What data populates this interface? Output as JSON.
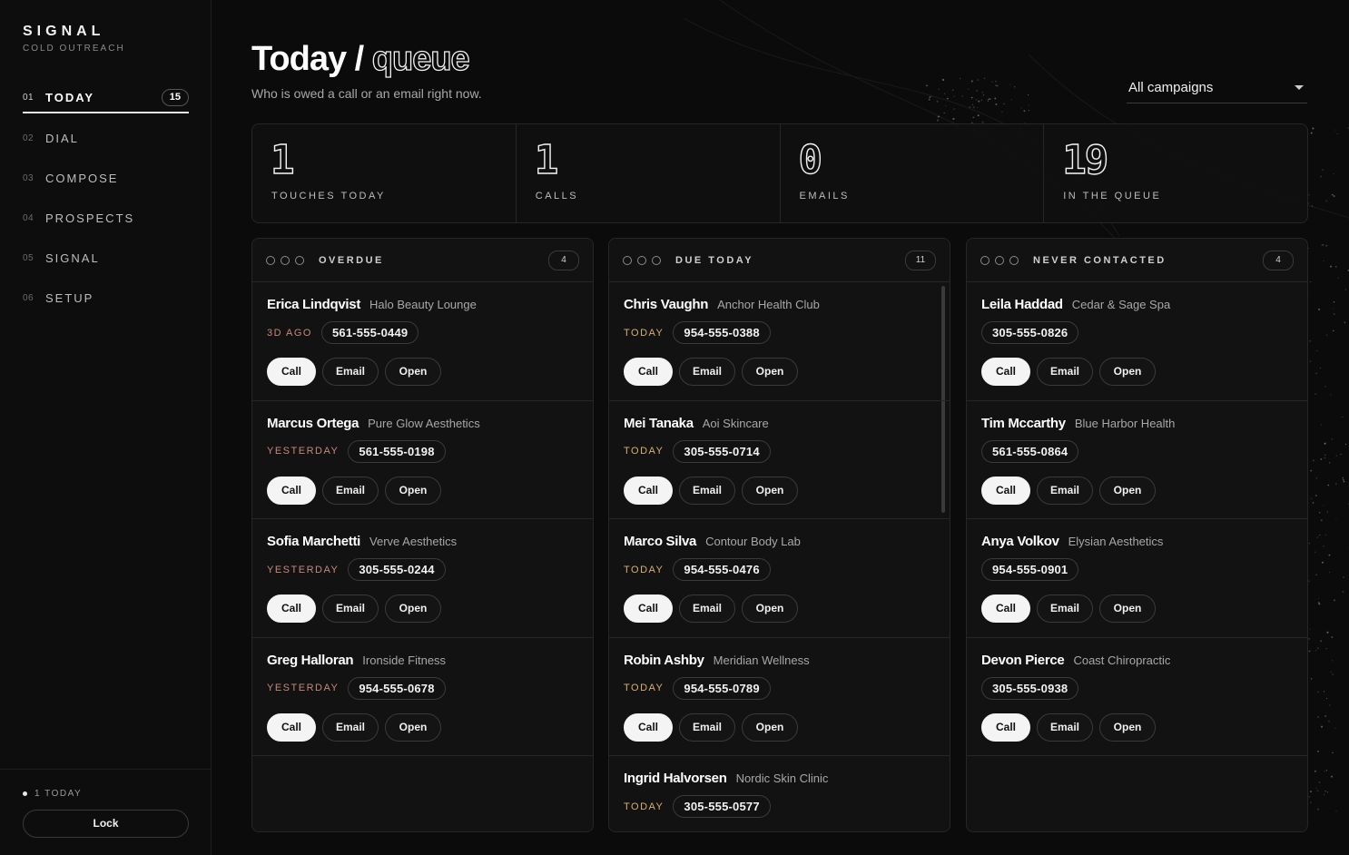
{
  "brand": {
    "name": "SIGNAL",
    "subtitle": "COLD OUTREACH"
  },
  "nav": [
    {
      "num": "01",
      "label": "TODAY",
      "badge": "15",
      "active": true
    },
    {
      "num": "02",
      "label": "DIAL"
    },
    {
      "num": "03",
      "label": "COMPOSE"
    },
    {
      "num": "04",
      "label": "PROSPECTS"
    },
    {
      "num": "05",
      "label": "SIGNAL"
    },
    {
      "num": "06",
      "label": "SETUP"
    }
  ],
  "footer": {
    "status": "1 TODAY",
    "lock_label": "Lock"
  },
  "header": {
    "title_main": "Today",
    "title_sep": " / ",
    "title_outline": "queue",
    "subtitle": "Who is owed a call or an email right now."
  },
  "campaign_filter": {
    "value": "All campaigns"
  },
  "stats": [
    {
      "value": "1",
      "label": "TOUCHES TODAY"
    },
    {
      "value": "1",
      "label": "CALLS"
    },
    {
      "value": "0",
      "label": "EMAILS"
    },
    {
      "value": "19",
      "label": "IN THE QUEUE"
    }
  ],
  "actions": {
    "call": "Call",
    "email": "Email",
    "open": "Open"
  },
  "columns": [
    {
      "title": "OVERDUE",
      "count": "4",
      "cards": [
        {
          "name": "Erica Lindqvist",
          "business": "Halo Beauty Lounge",
          "when": "3D AGO",
          "phone": "561-555-0449"
        },
        {
          "name": "Marcus Ortega",
          "business": "Pure Glow Aesthetics",
          "when": "YESTERDAY",
          "phone": "561-555-0198"
        },
        {
          "name": "Sofia Marchetti",
          "business": "Verve Aesthetics",
          "when": "YESTERDAY",
          "phone": "305-555-0244"
        },
        {
          "name": "Greg Halloran",
          "business": "Ironside Fitness",
          "when": "YESTERDAY",
          "phone": "954-555-0678"
        }
      ]
    },
    {
      "title": "DUE TODAY",
      "count": "11",
      "cards": [
        {
          "name": "Chris Vaughn",
          "business": "Anchor Health Club",
          "when": "TODAY",
          "phone": "954-555-0388"
        },
        {
          "name": "Mei Tanaka",
          "business": "Aoi Skincare",
          "when": "TODAY",
          "phone": "305-555-0714"
        },
        {
          "name": "Marco Silva",
          "business": "Contour Body Lab",
          "when": "TODAY",
          "phone": "954-555-0476"
        },
        {
          "name": "Robin Ashby",
          "business": "Meridian Wellness",
          "when": "TODAY",
          "phone": "954-555-0789"
        },
        {
          "name": "Ingrid Halvorsen",
          "business": "Nordic Skin Clinic",
          "when": "TODAY",
          "phone": "305-555-0577"
        }
      ]
    },
    {
      "title": "NEVER CONTACTED",
      "count": "4",
      "cards": [
        {
          "name": "Leila Haddad",
          "business": "Cedar & Sage Spa",
          "when": "",
          "phone": "305-555-0826"
        },
        {
          "name": "Tim Mccarthy",
          "business": "Blue Harbor Health",
          "when": "",
          "phone": "561-555-0864"
        },
        {
          "name": "Anya Volkov",
          "business": "Elysian Aesthetics",
          "when": "",
          "phone": "954-555-0901"
        },
        {
          "name": "Devon Pierce",
          "business": "Coast Chiropractic",
          "when": "",
          "phone": "305-555-0938"
        }
      ]
    }
  ]
}
